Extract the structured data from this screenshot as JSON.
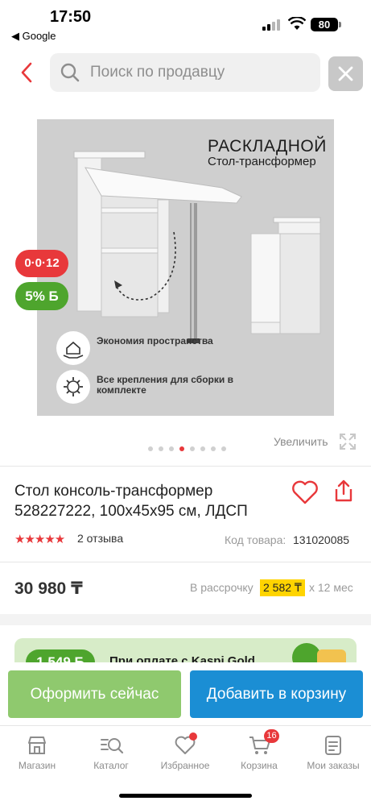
{
  "status_bar": {
    "time": "17:50",
    "back_app": "◀ Google",
    "battery": "80"
  },
  "search": {
    "placeholder": "Поиск по продавцу"
  },
  "product_image": {
    "title": "РАСКЛАДНОЙ",
    "subtitle": "Стол-трансформер",
    "features": [
      "Экономия пространства",
      "Все крепления для сборки в комплекте"
    ],
    "installment_badge": "0·0·12",
    "bonus_badge": "5% Б",
    "gallery_dots": 8,
    "active_dot": 3
  },
  "zoom_label": "Увеличить",
  "product": {
    "title": "Стол консоль-трансформер 528227222, 100x45x95 см, ЛДСП",
    "rating_stars": "★★★★★",
    "reviews": "2 отзыва",
    "code_label": "Код товара:",
    "code_value": "131020085",
    "price": "30 980 ₸",
    "installment_label": "В рассрочку",
    "installment_amount": "2 582 ₸",
    "installment_months": "х 12 мес"
  },
  "kaspi_banner": {
    "amount": "1 549 Б",
    "text": "При оплате с Kaspi Gold"
  },
  "actions": {
    "buy_now": "Оформить сейчас",
    "add_to_cart": "Добавить в корзину"
  },
  "tabs": [
    {
      "label": "Магазин",
      "icon": "shop-icon"
    },
    {
      "label": "Каталог",
      "icon": "catalog-icon"
    },
    {
      "label": "Избранное",
      "icon": "heart-icon"
    },
    {
      "label": "Корзина",
      "icon": "cart-icon",
      "badge": "16"
    },
    {
      "label": "Мои заказы",
      "icon": "orders-icon"
    }
  ],
  "colors": {
    "accent_red": "#e8383b",
    "kaspi_green": "#4ea52d",
    "action_blue": "#1b8ed4",
    "installment_yellow": "#ffd400"
  }
}
